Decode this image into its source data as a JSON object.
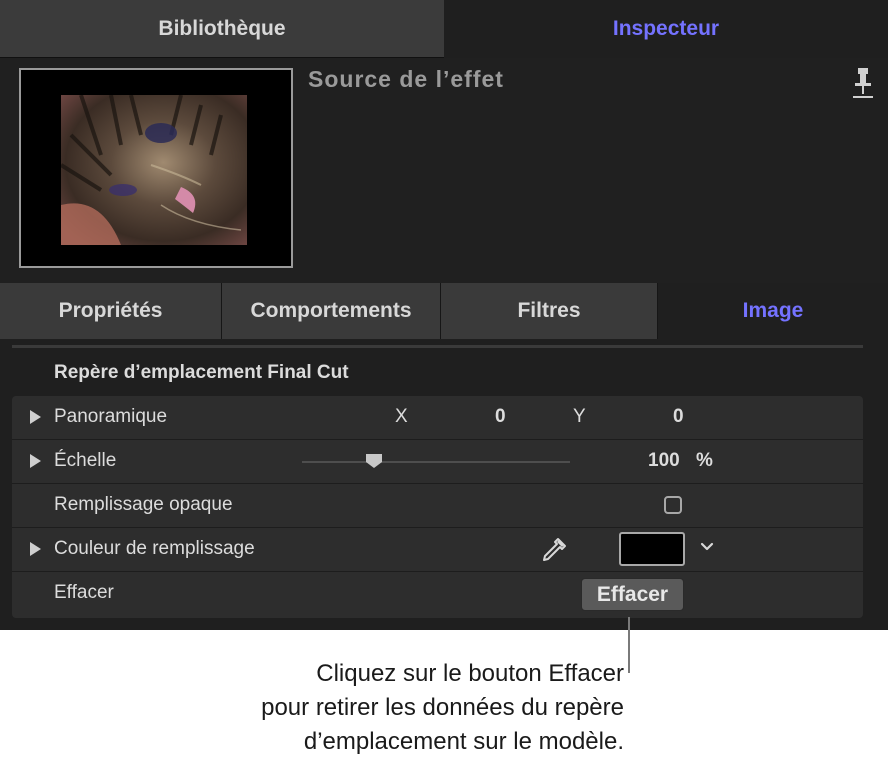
{
  "top_tabs": [
    {
      "label": "Bibliothèque",
      "active": false
    },
    {
      "label": "Inspecteur",
      "active": true
    }
  ],
  "header": {
    "title": "Source de l’effet",
    "pin_icon": "pin-icon"
  },
  "sub_tabs": [
    {
      "label": "Propriétés",
      "active": false
    },
    {
      "label": "Comportements",
      "active": false
    },
    {
      "label": "Filtres",
      "active": false
    },
    {
      "label": "Image",
      "active": true
    }
  ],
  "section": {
    "title": "Repère d’emplacement Final Cut",
    "rows": [
      {
        "label": "Panoramique",
        "x_label": "X",
        "x_value": "0",
        "y_label": "Y",
        "y_value": "0"
      },
      {
        "label": "Échelle",
        "value": "100",
        "unit": "%",
        "slider_fraction": 0.27
      },
      {
        "label": "Remplissage opaque",
        "checked": false
      },
      {
        "label": "Couleur de remplissage",
        "color": "#000000"
      },
      {
        "label": "Effacer",
        "button_label": "Effacer"
      }
    ]
  },
  "callout": {
    "line1": "Cliquez sur le bouton Effacer",
    "line2": "pour retirer les données du repère",
    "line3": "d’emplacement sur le modèle."
  },
  "colors": {
    "accent": "#7472ff",
    "panel_bg": "#1f1f1f"
  }
}
